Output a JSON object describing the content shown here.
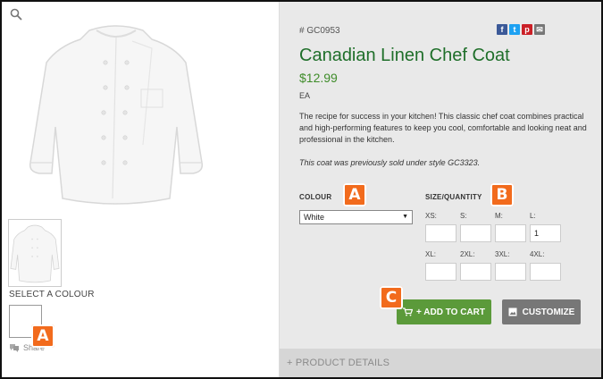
{
  "product": {
    "sku_prefix": "#",
    "sku": "GC0953",
    "title": "Canadian Linen Chef Coat",
    "price": "$12.99",
    "unit": "EA",
    "description": "The recipe for success in your kitchen! This classic chef coat combines practical and high-performing features to keep you cool, comfortable and looking neat and professional in the kitchen.",
    "note": "This coat was previously sold under style GC3323."
  },
  "gallery": {
    "zoom_icon": "search-icon",
    "select_colour_label": "SELECT A COLOUR",
    "share_label": "Share"
  },
  "social": [
    {
      "name": "facebook-icon",
      "glyph": "f",
      "color": "#3b5998"
    },
    {
      "name": "twitter-icon",
      "glyph": "t",
      "color": "#1da1f2"
    },
    {
      "name": "pinterest-icon",
      "glyph": "p",
      "color": "#cb2027"
    },
    {
      "name": "email-icon",
      "glyph": "✉",
      "color": "#777777"
    }
  ],
  "colour": {
    "label": "COLOUR",
    "selected": "White"
  },
  "sizes": {
    "label": "SIZE/QUANTITY",
    "cells": [
      {
        "size": "XS:",
        "qty": ""
      },
      {
        "size": "S:",
        "qty": ""
      },
      {
        "size": "M:",
        "qty": ""
      },
      {
        "size": "L:",
        "qty": "1"
      },
      {
        "size": "XL:",
        "qty": ""
      },
      {
        "size": "2XL:",
        "qty": ""
      },
      {
        "size": "3XL:",
        "qty": ""
      },
      {
        "size": "4XL:",
        "qty": ""
      }
    ]
  },
  "actions": {
    "add_to_cart": "+ ADD TO CART",
    "customize": "CUSTOMIZE"
  },
  "details": {
    "label": "+   PRODUCT DETAILS"
  },
  "callouts": {
    "a1": "A",
    "a2": "A",
    "b": "B",
    "c": "C"
  },
  "colors": {
    "title_green": "#1f6f2a",
    "price_green": "#3f8c2a",
    "cart_green": "#5b9a3a",
    "callout_orange": "#f26b1d",
    "panel_grey": "#e9e9e9"
  }
}
